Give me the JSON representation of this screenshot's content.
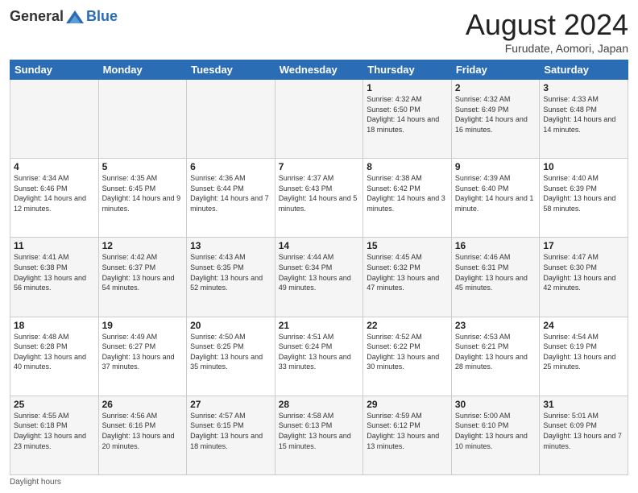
{
  "header": {
    "logo_general": "General",
    "logo_blue": "Blue",
    "month_title": "August 2024",
    "subtitle": "Furudate, Aomori, Japan"
  },
  "days_of_week": [
    "Sunday",
    "Monday",
    "Tuesday",
    "Wednesday",
    "Thursday",
    "Friday",
    "Saturday"
  ],
  "weeks": [
    [
      {
        "day": "",
        "sunrise": "",
        "sunset": "",
        "daylight": ""
      },
      {
        "day": "",
        "sunrise": "",
        "sunset": "",
        "daylight": ""
      },
      {
        "day": "",
        "sunrise": "",
        "sunset": "",
        "daylight": ""
      },
      {
        "day": "",
        "sunrise": "",
        "sunset": "",
        "daylight": ""
      },
      {
        "day": "1",
        "sunrise": "Sunrise: 4:32 AM",
        "sunset": "Sunset: 6:50 PM",
        "daylight": "Daylight: 14 hours and 18 minutes."
      },
      {
        "day": "2",
        "sunrise": "Sunrise: 4:32 AM",
        "sunset": "Sunset: 6:49 PM",
        "daylight": "Daylight: 14 hours and 16 minutes."
      },
      {
        "day": "3",
        "sunrise": "Sunrise: 4:33 AM",
        "sunset": "Sunset: 6:48 PM",
        "daylight": "Daylight: 14 hours and 14 minutes."
      }
    ],
    [
      {
        "day": "4",
        "sunrise": "Sunrise: 4:34 AM",
        "sunset": "Sunset: 6:46 PM",
        "daylight": "Daylight: 14 hours and 12 minutes."
      },
      {
        "day": "5",
        "sunrise": "Sunrise: 4:35 AM",
        "sunset": "Sunset: 6:45 PM",
        "daylight": "Daylight: 14 hours and 9 minutes."
      },
      {
        "day": "6",
        "sunrise": "Sunrise: 4:36 AM",
        "sunset": "Sunset: 6:44 PM",
        "daylight": "Daylight: 14 hours and 7 minutes."
      },
      {
        "day": "7",
        "sunrise": "Sunrise: 4:37 AM",
        "sunset": "Sunset: 6:43 PM",
        "daylight": "Daylight: 14 hours and 5 minutes."
      },
      {
        "day": "8",
        "sunrise": "Sunrise: 4:38 AM",
        "sunset": "Sunset: 6:42 PM",
        "daylight": "Daylight: 14 hours and 3 minutes."
      },
      {
        "day": "9",
        "sunrise": "Sunrise: 4:39 AM",
        "sunset": "Sunset: 6:40 PM",
        "daylight": "Daylight: 14 hours and 1 minute."
      },
      {
        "day": "10",
        "sunrise": "Sunrise: 4:40 AM",
        "sunset": "Sunset: 6:39 PM",
        "daylight": "Daylight: 13 hours and 58 minutes."
      }
    ],
    [
      {
        "day": "11",
        "sunrise": "Sunrise: 4:41 AM",
        "sunset": "Sunset: 6:38 PM",
        "daylight": "Daylight: 13 hours and 56 minutes."
      },
      {
        "day": "12",
        "sunrise": "Sunrise: 4:42 AM",
        "sunset": "Sunset: 6:37 PM",
        "daylight": "Daylight: 13 hours and 54 minutes."
      },
      {
        "day": "13",
        "sunrise": "Sunrise: 4:43 AM",
        "sunset": "Sunset: 6:35 PM",
        "daylight": "Daylight: 13 hours and 52 minutes."
      },
      {
        "day": "14",
        "sunrise": "Sunrise: 4:44 AM",
        "sunset": "Sunset: 6:34 PM",
        "daylight": "Daylight: 13 hours and 49 minutes."
      },
      {
        "day": "15",
        "sunrise": "Sunrise: 4:45 AM",
        "sunset": "Sunset: 6:32 PM",
        "daylight": "Daylight: 13 hours and 47 minutes."
      },
      {
        "day": "16",
        "sunrise": "Sunrise: 4:46 AM",
        "sunset": "Sunset: 6:31 PM",
        "daylight": "Daylight: 13 hours and 45 minutes."
      },
      {
        "day": "17",
        "sunrise": "Sunrise: 4:47 AM",
        "sunset": "Sunset: 6:30 PM",
        "daylight": "Daylight: 13 hours and 42 minutes."
      }
    ],
    [
      {
        "day": "18",
        "sunrise": "Sunrise: 4:48 AM",
        "sunset": "Sunset: 6:28 PM",
        "daylight": "Daylight: 13 hours and 40 minutes."
      },
      {
        "day": "19",
        "sunrise": "Sunrise: 4:49 AM",
        "sunset": "Sunset: 6:27 PM",
        "daylight": "Daylight: 13 hours and 37 minutes."
      },
      {
        "day": "20",
        "sunrise": "Sunrise: 4:50 AM",
        "sunset": "Sunset: 6:25 PM",
        "daylight": "Daylight: 13 hours and 35 minutes."
      },
      {
        "day": "21",
        "sunrise": "Sunrise: 4:51 AM",
        "sunset": "Sunset: 6:24 PM",
        "daylight": "Daylight: 13 hours and 33 minutes."
      },
      {
        "day": "22",
        "sunrise": "Sunrise: 4:52 AM",
        "sunset": "Sunset: 6:22 PM",
        "daylight": "Daylight: 13 hours and 30 minutes."
      },
      {
        "day": "23",
        "sunrise": "Sunrise: 4:53 AM",
        "sunset": "Sunset: 6:21 PM",
        "daylight": "Daylight: 13 hours and 28 minutes."
      },
      {
        "day": "24",
        "sunrise": "Sunrise: 4:54 AM",
        "sunset": "Sunset: 6:19 PM",
        "daylight": "Daylight: 13 hours and 25 minutes."
      }
    ],
    [
      {
        "day": "25",
        "sunrise": "Sunrise: 4:55 AM",
        "sunset": "Sunset: 6:18 PM",
        "daylight": "Daylight: 13 hours and 23 minutes."
      },
      {
        "day": "26",
        "sunrise": "Sunrise: 4:56 AM",
        "sunset": "Sunset: 6:16 PM",
        "daylight": "Daylight: 13 hours and 20 minutes."
      },
      {
        "day": "27",
        "sunrise": "Sunrise: 4:57 AM",
        "sunset": "Sunset: 6:15 PM",
        "daylight": "Daylight: 13 hours and 18 minutes."
      },
      {
        "day": "28",
        "sunrise": "Sunrise: 4:58 AM",
        "sunset": "Sunset: 6:13 PM",
        "daylight": "Daylight: 13 hours and 15 minutes."
      },
      {
        "day": "29",
        "sunrise": "Sunrise: 4:59 AM",
        "sunset": "Sunset: 6:12 PM",
        "daylight": "Daylight: 13 hours and 13 minutes."
      },
      {
        "day": "30",
        "sunrise": "Sunrise: 5:00 AM",
        "sunset": "Sunset: 6:10 PM",
        "daylight": "Daylight: 13 hours and 10 minutes."
      },
      {
        "day": "31",
        "sunrise": "Sunrise: 5:01 AM",
        "sunset": "Sunset: 6:09 PM",
        "daylight": "Daylight: 13 hours and 7 minutes."
      }
    ]
  ],
  "footer": {
    "note": "Daylight hours"
  }
}
